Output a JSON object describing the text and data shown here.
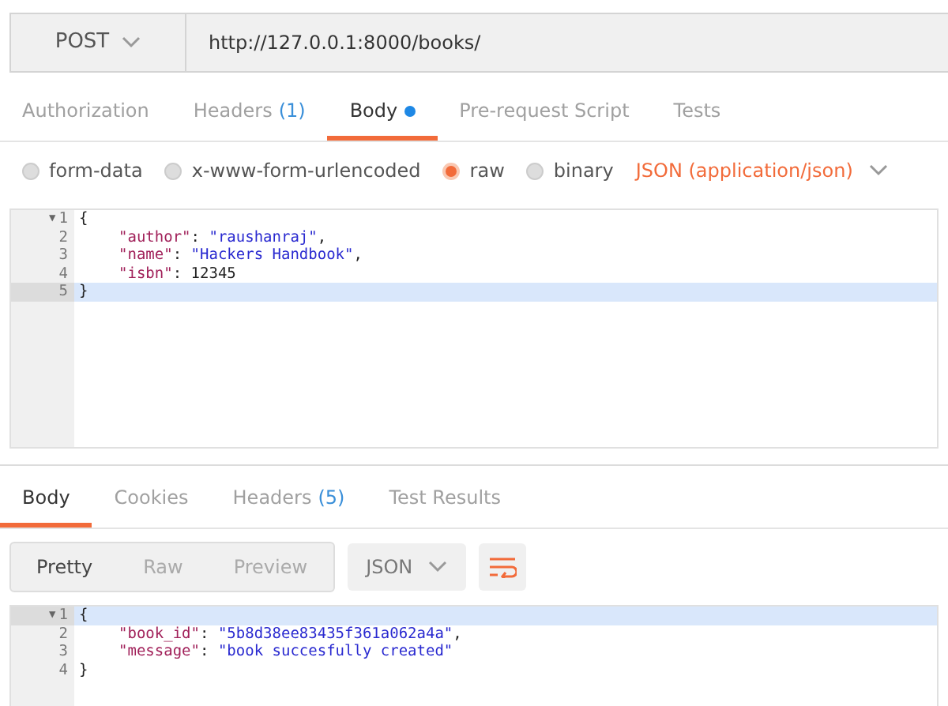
{
  "request": {
    "method": "POST",
    "url": "http://127.0.0.1:8000/books/"
  },
  "request_tabs": [
    {
      "label": "Authorization",
      "selected": false
    },
    {
      "label": "Headers",
      "count": "(1)",
      "selected": false
    },
    {
      "label": "Body",
      "selected": true,
      "dot": true
    },
    {
      "label": "Pre-request Script",
      "selected": false
    },
    {
      "label": "Tests",
      "selected": false
    }
  ],
  "body_types": [
    {
      "label": "form-data",
      "selected": false
    },
    {
      "label": "x-www-form-urlencoded",
      "selected": false
    },
    {
      "label": "raw",
      "selected": true
    },
    {
      "label": "binary",
      "selected": false
    }
  ],
  "content_type": "JSON (application/json)",
  "request_body": [
    {
      "number": "1",
      "fold": "▼",
      "kind": "brace",
      "highlighted": false,
      "tokens": [
        {
          "kind": "punct",
          "text": "{"
        }
      ]
    },
    {
      "number": "2",
      "kind": "member",
      "highlighted": false,
      "tokens": [
        {
          "kind": "key",
          "text": "\"author\""
        },
        {
          "kind": "punct",
          "text": ": "
        },
        {
          "kind": "string",
          "text": "\"raushanraj\""
        },
        {
          "kind": "punct",
          "text": ","
        }
      ]
    },
    {
      "number": "3",
      "kind": "member",
      "highlighted": false,
      "tokens": [
        {
          "kind": "key",
          "text": "\"name\""
        },
        {
          "kind": "punct",
          "text": ": "
        },
        {
          "kind": "string",
          "text": "\"Hackers Handbook\""
        },
        {
          "kind": "punct",
          "text": ","
        }
      ]
    },
    {
      "number": "4",
      "kind": "member",
      "highlighted": false,
      "tokens": [
        {
          "kind": "key",
          "text": "\"isbn\""
        },
        {
          "kind": "punct",
          "text": ": "
        },
        {
          "kind": "number",
          "text": "12345"
        }
      ]
    },
    {
      "number": "5",
      "kind": "brace",
      "highlighted": true,
      "tokens": [
        {
          "kind": "punct",
          "text": "}"
        }
      ]
    }
  ],
  "response_tabs": [
    {
      "label": "Body",
      "selected": true
    },
    {
      "label": "Cookies",
      "selected": false
    },
    {
      "label": "Headers",
      "count": "(5)",
      "selected": false
    },
    {
      "label": "Test Results",
      "selected": false
    }
  ],
  "view_modes": [
    {
      "label": "Pretty",
      "selected": true
    },
    {
      "label": "Raw",
      "selected": false
    },
    {
      "label": "Preview",
      "selected": false
    }
  ],
  "format": "JSON",
  "response_body": [
    {
      "number": "1",
      "fold": "▼",
      "kind": "brace",
      "highlighted": true,
      "tokens": [
        {
          "kind": "punct",
          "text": "{"
        }
      ]
    },
    {
      "number": "2",
      "kind": "member",
      "highlighted": false,
      "tokens": [
        {
          "kind": "key",
          "text": "\"book_id\""
        },
        {
          "kind": "punct",
          "text": ": "
        },
        {
          "kind": "string",
          "text": "\"5b8d38ee83435f361a062a4a\""
        },
        {
          "kind": "punct",
          "text": ","
        }
      ]
    },
    {
      "number": "3",
      "kind": "member",
      "highlighted": false,
      "tokens": [
        {
          "kind": "key",
          "text": "\"message\""
        },
        {
          "kind": "punct",
          "text": ": "
        },
        {
          "kind": "string",
          "text": "\"book succesfully created\""
        }
      ]
    },
    {
      "number": "4",
      "kind": "brace",
      "highlighted": false,
      "tokens": [
        {
          "kind": "punct",
          "text": "}"
        }
      ]
    }
  ]
}
